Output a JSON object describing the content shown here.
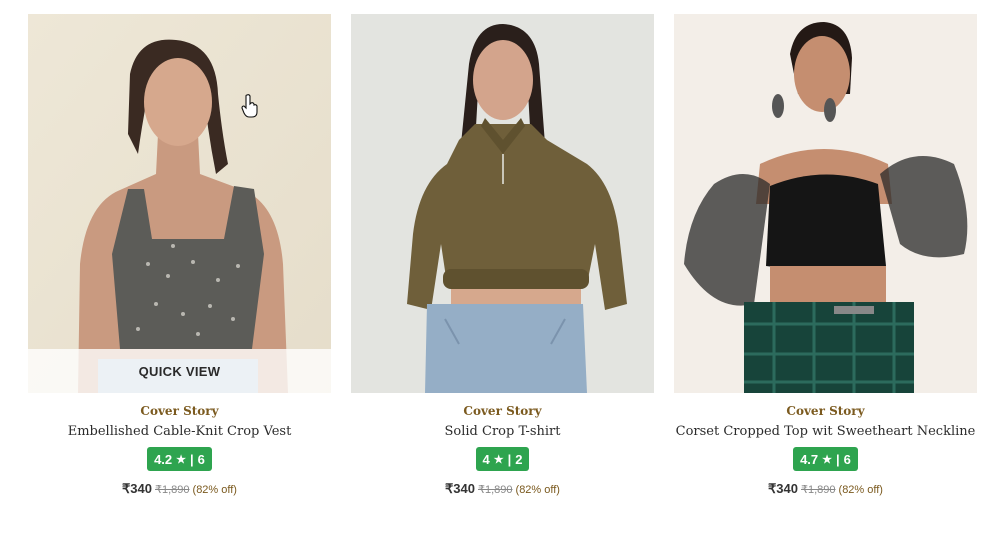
{
  "colors": {
    "brand_text": "#7b5a1f",
    "rating_badge": "#2ea44f",
    "quick_view_overlay": "rgba(255,255,255,0.78)"
  },
  "products": [
    {
      "brand": "Cover Story",
      "title": "Embellished Cable-Knit Crop Vest",
      "rating": "4.2",
      "star_icon": "★",
      "rating_sep": "|",
      "reviews": "6",
      "price": "₹340",
      "mrp": "₹1,890",
      "discount": "(82% off)",
      "quick_view_label": "QUICK VIEW",
      "image_icon": "woman-grey-knit-vest-photo"
    },
    {
      "brand": "Cover Story",
      "title": "Solid Crop T-shirt",
      "rating": "4",
      "star_icon": "★",
      "rating_sep": "|",
      "reviews": "2",
      "price": "₹340",
      "mrp": "₹1,890",
      "discount": "(82% off)",
      "image_icon": "woman-olive-crop-sweatshirt-photo"
    },
    {
      "brand": "Cover Story",
      "title": "Corset Cropped Top wit Sweetheart Neckline",
      "rating": "4.7",
      "star_icon": "★",
      "rating_sep": "|",
      "reviews": "6",
      "price": "₹340",
      "mrp": "₹1,890",
      "discount": "(82% off)",
      "image_icon": "woman-black-corset-top-photo"
    }
  ],
  "cursor_icon": "hand-pointer-icon"
}
